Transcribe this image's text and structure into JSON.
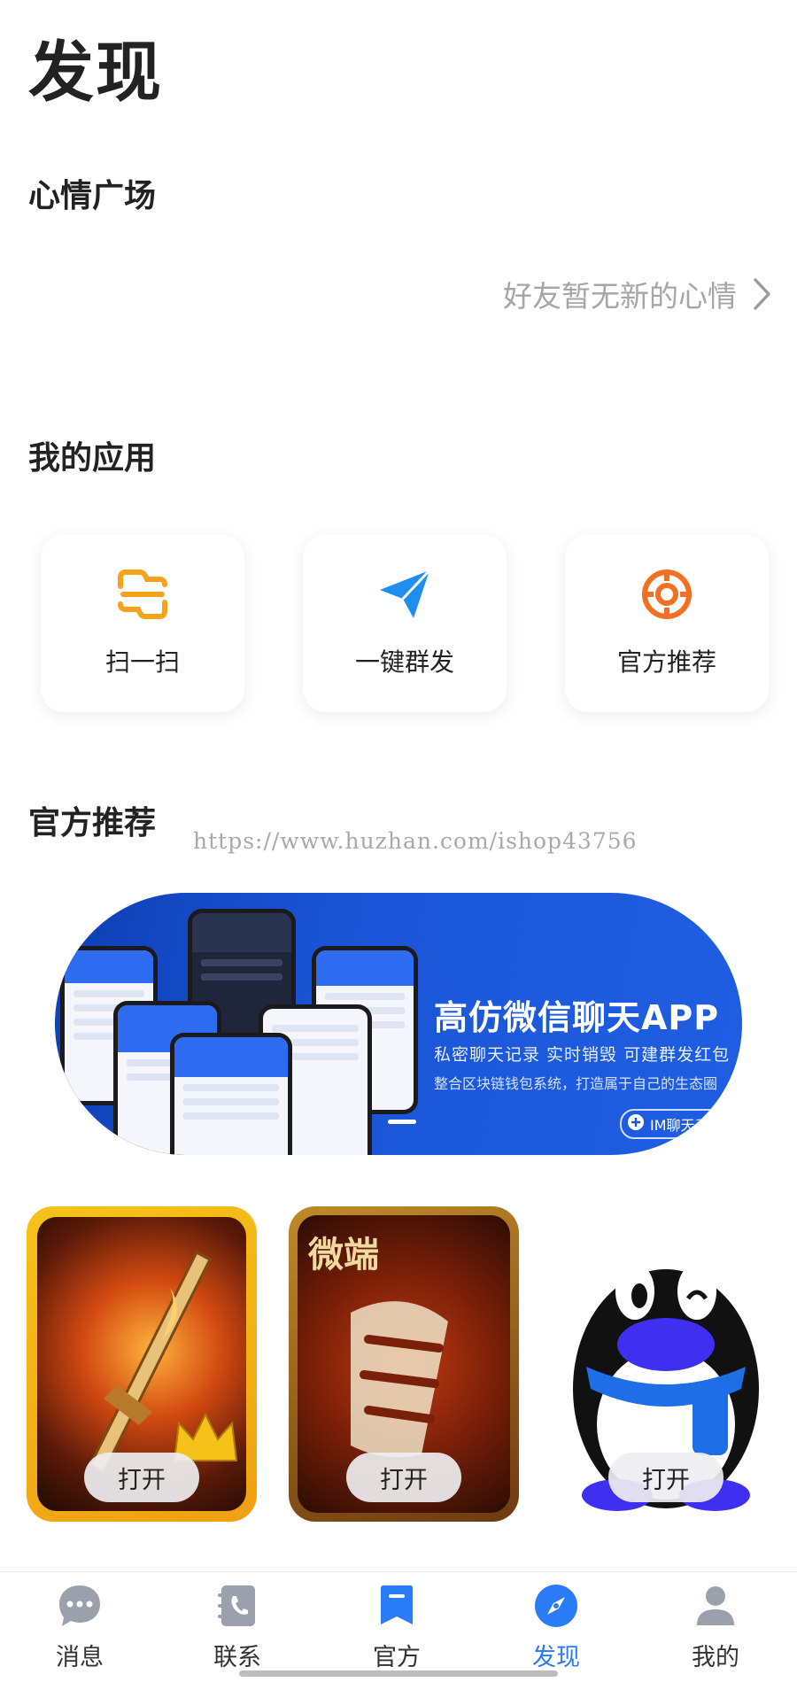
{
  "page_title": "发现",
  "mood": {
    "title": "心情广场",
    "empty_text": "好友暂无新的心情"
  },
  "my_apps": {
    "title": "我的应用",
    "items": [
      {
        "label": "扫一扫",
        "icon": "scan-icon"
      },
      {
        "label": "一键群发",
        "icon": "paper-plane-icon"
      },
      {
        "label": "官方推荐",
        "icon": "target-icon"
      }
    ]
  },
  "recommend": {
    "title": "官方推荐",
    "watermark": "https://www.huzhan.com/ishop43756",
    "banner": {
      "headline": "高仿微信聊天APP",
      "sub1": "私密聊天记录   实时销毁   可建群发红包",
      "sub2": "整合区块链钱包系统，打造属于自己的生态圈",
      "badge": "IM聊天系统"
    },
    "games": [
      {
        "open_label": "打开",
        "icon": "sword-game-icon"
      },
      {
        "open_label": "打开",
        "icon": "dragon-game-icon",
        "art_text": "微端"
      },
      {
        "open_label": "打开",
        "icon": "penguin-icon"
      }
    ]
  },
  "tabs": [
    {
      "label": "消息",
      "icon": "chat-bubble-icon",
      "active": false
    },
    {
      "label": "联系",
      "icon": "contacts-book-icon",
      "active": false
    },
    {
      "label": "官方",
      "icon": "bookmark-icon",
      "active": false
    },
    {
      "label": "发现",
      "icon": "compass-icon",
      "active": true
    },
    {
      "label": "我的",
      "icon": "person-icon",
      "active": false
    }
  ],
  "colors": {
    "accent": "#2a7bf6",
    "scan_orange": "#f7a21b",
    "target_orange": "#f36f21",
    "plane_blue": "#1f8ef1"
  }
}
